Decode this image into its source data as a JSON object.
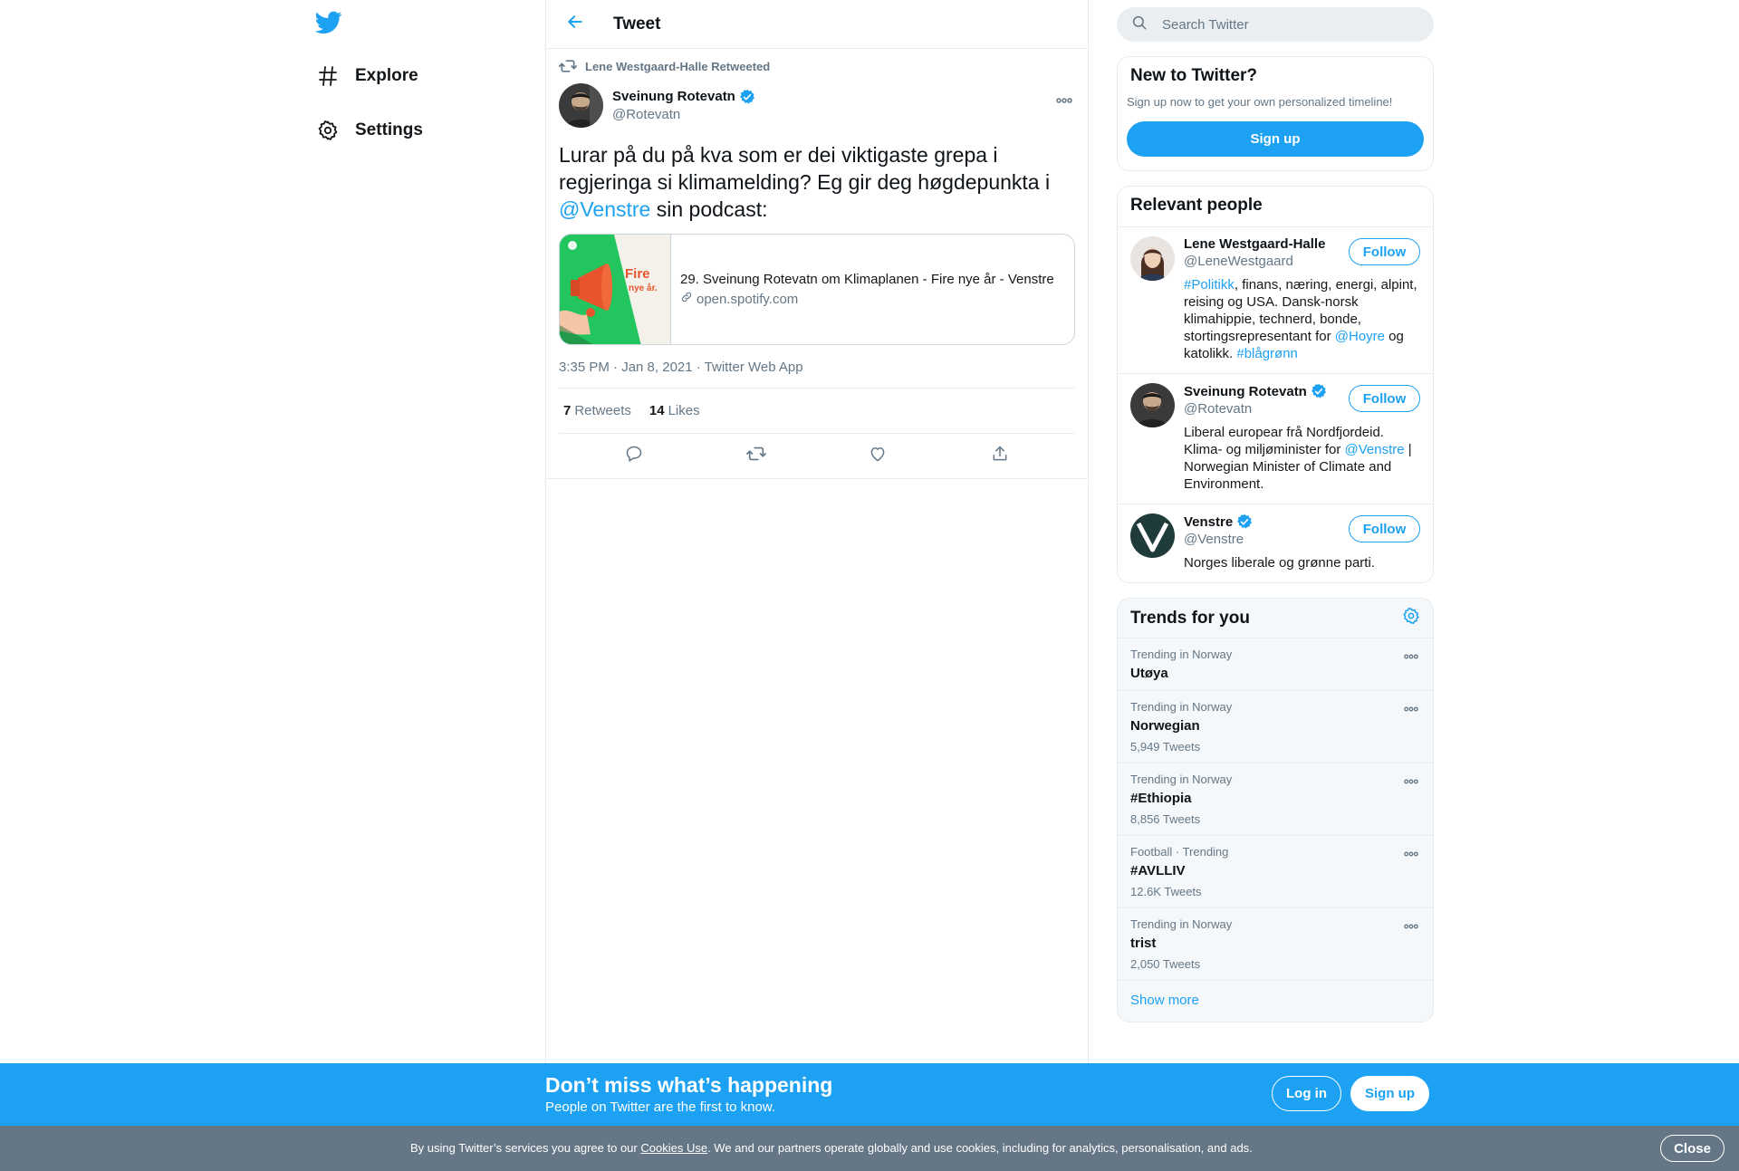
{
  "colors": {
    "accent": "#1da1f2",
    "muted": "#657786",
    "text": "#0f1419",
    "border": "#e6ecf0",
    "promo_bg": "#1da1f2",
    "cookie_bg": "#657786"
  },
  "nav": {
    "logo_icon": "twitter-bird-icon",
    "items": [
      {
        "icon": "hashtag-icon",
        "label": "Explore"
      },
      {
        "icon": "gear-icon",
        "label": "Settings"
      }
    ]
  },
  "header": {
    "back_icon": "arrow-left-icon",
    "title": "Tweet"
  },
  "tweet": {
    "retweeted_by": "Lene Westgaard-Halle Retweeted",
    "author_name": "Sveinung Rotevatn",
    "author_handle": "@Rotevatn",
    "text_before": "Lurar på du på kva som er dei viktigaste grepa i regjeringa si klimamelding? Eg gir deg høgdepunkta i ",
    "text_mention": "@Venstre",
    "text_after": " sin podcast:",
    "card": {
      "image_text_1": "Fire",
      "image_text_2": "nye år.",
      "title": "29. Sveinung Rotevatn om Klimaplanen - Fire nye år - Venstre",
      "domain": "open.spotify.com"
    },
    "timestamp": "3:35 PM · Jan 8, 2021 · Twitter Web App",
    "retweets_count": "7",
    "retweets_label": "Retweets",
    "likes_count": "14",
    "likes_label": "Likes",
    "actions": [
      "reply-icon",
      "retweet-icon",
      "like-icon",
      "share-icon"
    ]
  },
  "search": {
    "placeholder": "Search Twitter"
  },
  "new_to_twitter": {
    "title": "New to Twitter?",
    "subtitle": "Sign up now to get your own personalized timeline!",
    "button": "Sign up"
  },
  "relevant_people": {
    "title": "Relevant people",
    "follow_label": "Follow",
    "people": [
      {
        "name": "Lene Westgaard-Halle",
        "handle": "@LeneWestgaard",
        "verified": false,
        "bio_parts": [
          {
            "text": "#Politikk",
            "link": true
          },
          {
            "text": ", finans, næring, energi, alpint, reising og USA. Dansk-norsk klimahippie, technerd, bonde, stortingsrepresentant for ",
            "link": false
          },
          {
            "text": "@Hoyre",
            "link": true
          },
          {
            "text": " og katolikk. ",
            "link": false
          },
          {
            "text": "#blågrønn",
            "link": true
          }
        ]
      },
      {
        "name": "Sveinung Rotevatn",
        "handle": "@Rotevatn",
        "verified": true,
        "bio_parts": [
          {
            "text": "Liberal europear frå Nordfjordeid. Klima- og miljøminister for ",
            "link": false
          },
          {
            "text": "@Venstre",
            "link": true
          },
          {
            "text": " | Norwegian Minister of Climate and Environment.",
            "link": false
          }
        ]
      },
      {
        "name": "Venstre",
        "handle": "@Venstre",
        "verified": true,
        "bio_parts": [
          {
            "text": "Norges liberale og grønne parti.",
            "link": false
          }
        ]
      }
    ]
  },
  "trends": {
    "title": "Trends for you",
    "items": [
      {
        "context": "Trending in Norway",
        "name": "Utøya",
        "count": ""
      },
      {
        "context": "Trending in Norway",
        "name": "Norwegian",
        "count": "5,949 Tweets"
      },
      {
        "context": "Trending in Norway",
        "name": "#Ethiopia",
        "count": "8,856 Tweets"
      },
      {
        "context": "Football · Trending",
        "name": "#AVLLIV",
        "count": "12.6K Tweets"
      },
      {
        "context": "Trending in Norway",
        "name": "trist",
        "count": "2,050 Tweets"
      }
    ],
    "show_more": "Show more"
  },
  "promo": {
    "title": "Don’t miss what’s happening",
    "subtitle": "People on Twitter are the first to know.",
    "login": "Log in",
    "signup": "Sign up"
  },
  "cookie": {
    "before": "By using Twitter’s services you agree to our ",
    "link": "Cookies Use",
    "after": ". We and our partners operate globally and use cookies, including for analytics, personalisation, and ads.",
    "close": "Close"
  }
}
